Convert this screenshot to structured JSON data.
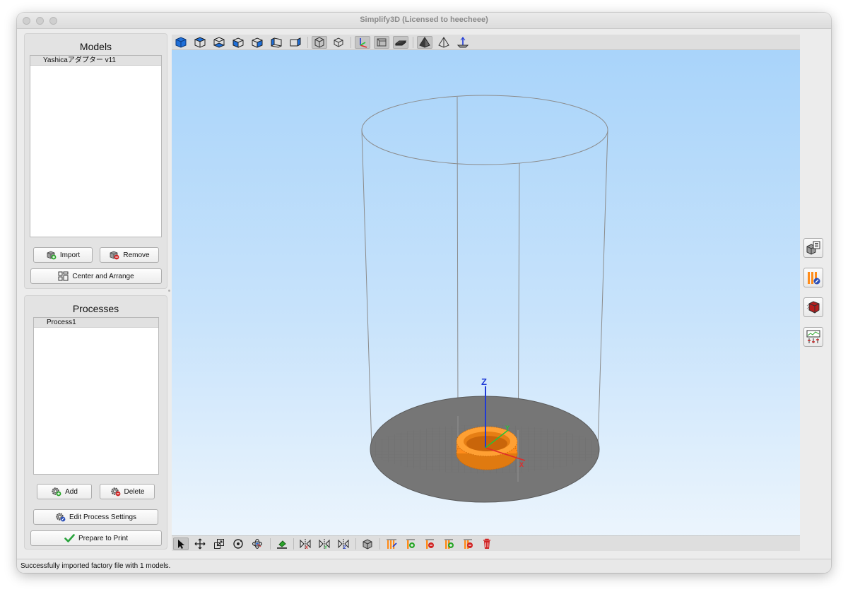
{
  "window": {
    "title": "Simplify3D (Licensed to heecheee)"
  },
  "models_panel": {
    "title": "Models",
    "items": [
      {
        "label": "Yashicaアダプター v11"
      }
    ],
    "import_label": "Import",
    "remove_label": "Remove",
    "center_arrange_label": "Center and Arrange"
  },
  "processes_panel": {
    "title": "Processes",
    "items": [
      {
        "label": "Process1"
      }
    ],
    "add_label": "Add",
    "delete_label": "Delete",
    "edit_label": "Edit Process Settings",
    "prepare_label": "Prepare to Print"
  },
  "top_toolbar": {
    "icons": [
      "view-default-icon",
      "view-top-icon",
      "view-bottom-icon",
      "view-front-icon",
      "view-back-icon",
      "view-left-icon",
      "view-right-icon",
      "perspective-icon",
      "orthographic-icon",
      "axes-toggle-icon",
      "build-volume-toggle-icon",
      "bed-toggle-icon",
      "solid-mode-icon",
      "wireframe-mode-icon",
      "ground-plane-icon"
    ]
  },
  "bottom_toolbar": {
    "icons": [
      "select-tool-icon",
      "move-tool-icon",
      "scale-tool-icon",
      "rotate-tool-icon",
      "orbit-tool-icon",
      "place-on-bed-icon",
      "mirror-x-icon",
      "mirror-y-icon",
      "mirror-z-icon",
      "repair-model-icon",
      "support-editor-icon",
      "add-support-icon",
      "remove-support-icon",
      "add-support-2-icon",
      "remove-support-2-icon",
      "delete-supports-icon"
    ]
  },
  "right_toolbar": {
    "icons": [
      "model-settings-icon",
      "variable-settings-icon",
      "part-cutting-icon",
      "machine-control-icon"
    ]
  },
  "colors": {
    "viewport_top": "#a7d3fa",
    "bed": "#7a7a7a",
    "model": "#ff8c1a",
    "accent_blue": "#1e6fd9"
  },
  "status": {
    "text": "Successfully imported factory file with 1 models."
  }
}
